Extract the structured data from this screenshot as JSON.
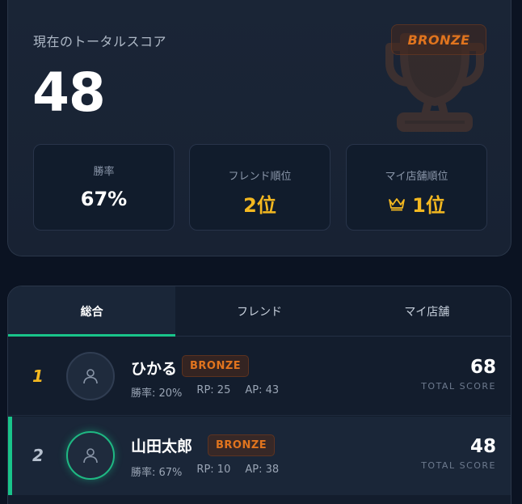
{
  "score_card": {
    "title": "現在のトータルスコア",
    "score": "48",
    "rank_badge": "BRONZE",
    "stats": [
      {
        "label": "勝率",
        "value": "67%"
      },
      {
        "label": "フレンド順位",
        "value": "2位"
      },
      {
        "label": "マイ店舗順位",
        "value": "1位"
      }
    ]
  },
  "tabs": [
    {
      "label": "総合"
    },
    {
      "label": "フレンド"
    },
    {
      "label": "マイ店舗"
    }
  ],
  "ranking": [
    {
      "rank": "1",
      "name": "ひかる",
      "tier": "BRONZE",
      "winrate": "勝率: 20%",
      "rp": "RP: 25",
      "ap": "AP: 43",
      "score": "68",
      "score_label": "TOTAL SCORE"
    },
    {
      "rank": "2",
      "name": "山田太郎",
      "tier": "BRONZE",
      "winrate": "勝率: 67%",
      "rp": "RP: 10",
      "ap": "AP: 38",
      "score": "48",
      "score_label": "TOTAL SCORE"
    }
  ],
  "colors": {
    "background": "#0b1322",
    "accent_green": "#19c48a",
    "gold": "#f4b820",
    "bronze": "#e0741e"
  },
  "icons": [
    "trophy-icon",
    "crown-icon",
    "user-icon"
  ]
}
